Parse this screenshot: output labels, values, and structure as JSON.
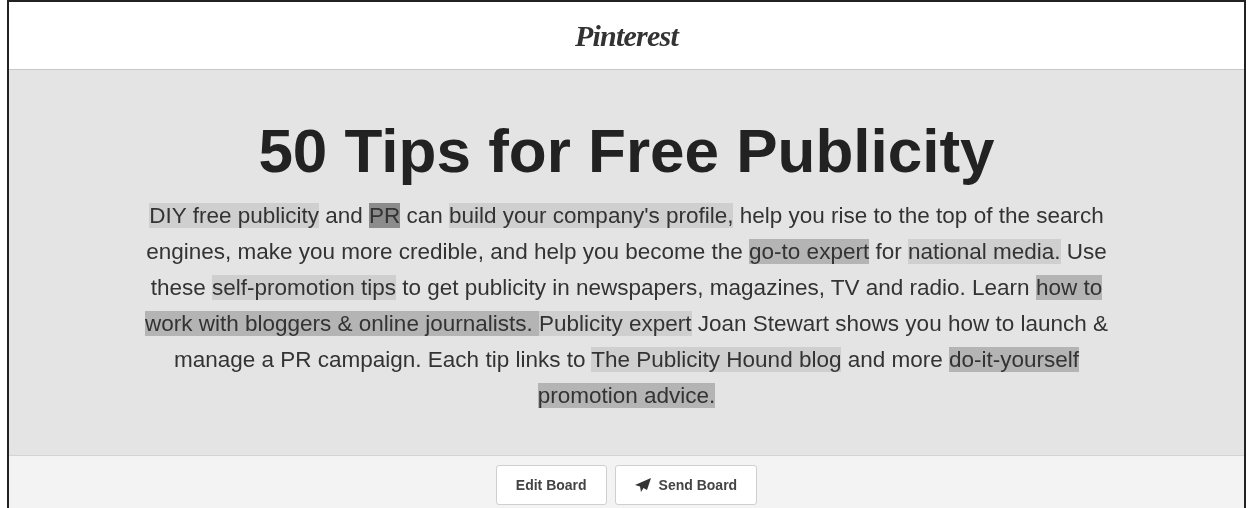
{
  "header": {
    "logo": "Pinterest"
  },
  "board": {
    "title": "50 Tips for Free Publicity",
    "description": [
      {
        "text": "DIY free publicity",
        "kind": "light"
      },
      {
        "text": " and ",
        "kind": "none"
      },
      {
        "text": "PR",
        "kind": "dark"
      },
      {
        "text": " can ",
        "kind": "none"
      },
      {
        "text": "build your company's profile,",
        "kind": "light"
      },
      {
        "text": " help you rise to the top of the search engines, make you more credible, and help you become the ",
        "kind": "none"
      },
      {
        "text": "go-to expert",
        "kind": "medium"
      },
      {
        "text": " for ",
        "kind": "none"
      },
      {
        "text": "national media.",
        "kind": "light"
      },
      {
        "text": " Use these ",
        "kind": "none"
      },
      {
        "text": "self-promotion tips",
        "kind": "light"
      },
      {
        "text": " to get publicity in newspapers, magazines, TV and radio. Learn ",
        "kind": "none"
      },
      {
        "text": "how to work with bloggers & online journalists. ",
        "kind": "medium"
      },
      {
        "text": "Publicity expert",
        "kind": "light"
      },
      {
        "text": " Joan Stewart shows you how to launch & manage a PR campaign. Each tip links to ",
        "kind": "none"
      },
      {
        "text": "The Publicity Hound blog",
        "kind": "light"
      },
      {
        "text": " and more ",
        "kind": "none"
      },
      {
        "text": "do-it-yourself promotion advice.",
        "kind": "medium"
      }
    ]
  },
  "buttons": [
    {
      "label": "Edit Board",
      "kind": "plain"
    },
    {
      "label": "Send Board",
      "kind": "send"
    }
  ]
}
